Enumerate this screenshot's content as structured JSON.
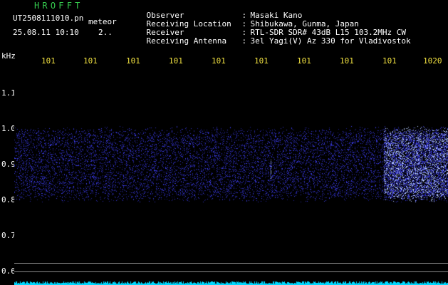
{
  "header": {
    "app_title": "HROFFT",
    "file_name": "UT2508111010.pn",
    "event_type": "meteor",
    "date_time": "25.08.11 10:10",
    "page_indicator": "2.."
  },
  "station_info": [
    {
      "label": "Observer",
      "value": "Masaki Kano"
    },
    {
      "label": "Receiving Location",
      "value": "Shibukawa, Gunma, Japan"
    },
    {
      "label": "Receiver",
      "value": "RTL-SDR SDR# 43dB L15 103.2MHz CW"
    },
    {
      "label": "Receiving Antenna",
      "value": "3el Yagi(V) Az 330 for Vladivostok"
    }
  ],
  "info_separator": ":",
  "time_axis": {
    "ticks": [
      "101",
      "101",
      "101",
      "101",
      "101",
      "101",
      "101",
      "101",
      "101",
      "1020"
    ]
  },
  "freq_axis": {
    "unit": "kHz",
    "ticks": [
      {
        "label": "1.1",
        "value": 1.1
      },
      {
        "label": "1.0",
        "value": 1.0
      },
      {
        "label": "0.9",
        "value": 0.9
      },
      {
        "label": "0.8",
        "value": 0.8
      },
      {
        "label": "0.7",
        "value": 0.7
      },
      {
        "label": "0.6",
        "value": 0.6
      }
    ]
  },
  "colors": {
    "background": "#000000",
    "noise": "#2a2ae0",
    "signal": "#ffffff",
    "baseline": "#00d8ff",
    "title": "#35c94e",
    "axis_time": "#f0e040"
  }
}
